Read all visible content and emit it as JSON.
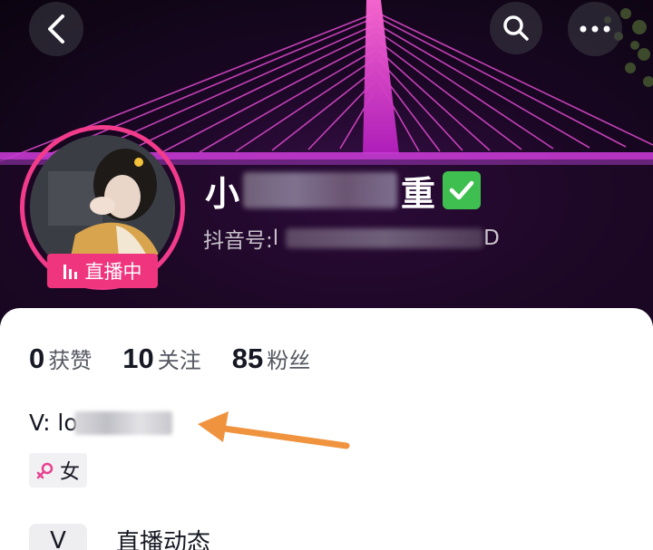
{
  "header": {
    "back_icon": "chevron-left-icon",
    "search_icon": "search-icon",
    "more_icon": "more-horizontal-icon"
  },
  "profile": {
    "name_prefix": "小",
    "name_suffix": "重",
    "verified_icon": "check-badge-icon",
    "live_badge": "直播中",
    "id_label": "抖音号: ",
    "id_prefix": "l",
    "id_suffix": "D"
  },
  "stats": [
    {
      "value": "0",
      "label": "获赞"
    },
    {
      "value": "10",
      "label": "关注"
    },
    {
      "value": "85",
      "label": "粉丝"
    }
  ],
  "bio": {
    "text_prefix": "V: lo"
  },
  "gender_tag": {
    "icon": "female-icon",
    "label": "女"
  },
  "live_section": {
    "icon_text": "V",
    "label": "直播动态"
  },
  "colors": {
    "accent_pink": "#f0357f",
    "verified_green": "#3fbf4f",
    "arrow_orange": "#f0933f"
  }
}
